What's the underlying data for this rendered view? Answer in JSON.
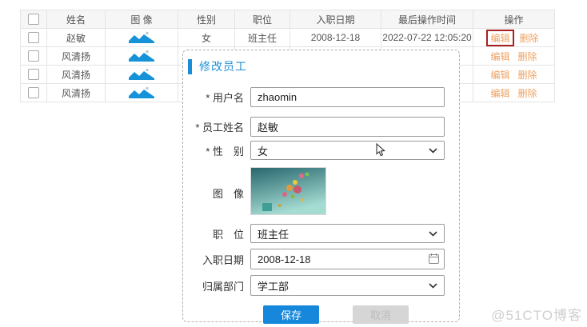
{
  "colors": {
    "accent_blue": "#1a8cd8",
    "link_orange": "#efa263",
    "highlight_red": "#a82022"
  },
  "table": {
    "headers": {
      "name": "姓名",
      "image": "图  像",
      "gender": "性别",
      "position": "职位",
      "hire_date": "入职日期",
      "last_op_time": "最后操作时间",
      "actions": "操作"
    },
    "rows": [
      {
        "name": "赵敏",
        "gender": "女",
        "position": "班主任",
        "hire_date": "2008-12-18",
        "last_op_time": "2022-07-22 12:05:20",
        "edit": "编辑",
        "delete": "删除"
      },
      {
        "name": "风清扬",
        "gender": "",
        "position": "",
        "hire_date": "",
        "last_op_time": "",
        "edit": "编辑",
        "delete": "删除"
      },
      {
        "name": "风清扬",
        "gender": "",
        "position": "",
        "hire_date": "",
        "last_op_time": "",
        "edit": "编辑",
        "delete": "删除"
      },
      {
        "name": "风清扬",
        "gender": "",
        "position": "",
        "hire_date": "",
        "last_op_time": "",
        "edit": "编辑",
        "delete": "删除"
      }
    ]
  },
  "modal": {
    "title": "修改员工",
    "fields": {
      "username": {
        "label": "* 用户名",
        "value": "zhaomin"
      },
      "employee_name": {
        "label": "* 员工姓名",
        "value": "赵敏"
      },
      "gender": {
        "label": "* 性　别",
        "value": "女"
      },
      "image": {
        "label": "图　像"
      },
      "position": {
        "label": "职　位",
        "value": "班主任"
      },
      "hire_date": {
        "label": "入职日期",
        "value": "2008-12-18"
      },
      "department": {
        "label": "归属部门",
        "value": "学工部"
      }
    },
    "buttons": {
      "save": "保存",
      "cancel": "取消"
    }
  },
  "watermark": "@51CTO博客"
}
